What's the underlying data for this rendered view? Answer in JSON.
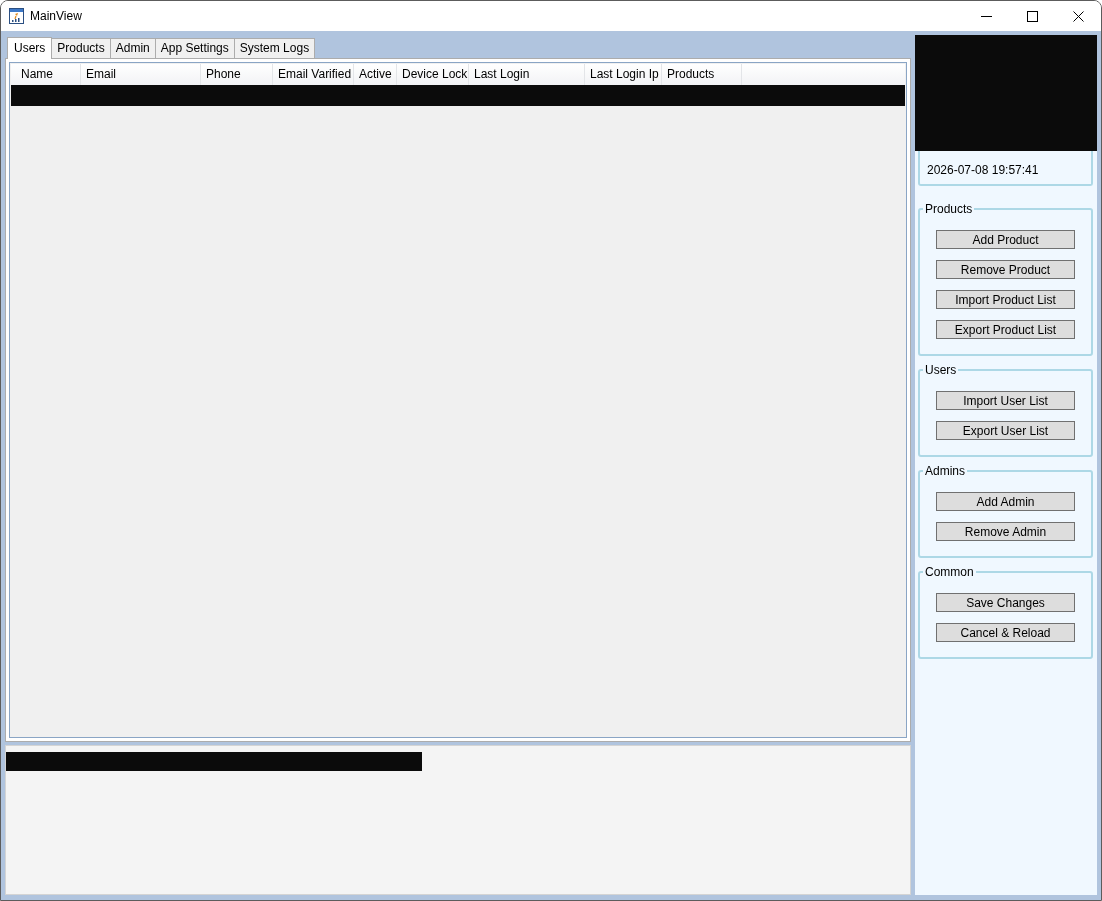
{
  "window": {
    "title": "MainView"
  },
  "tabs": [
    {
      "label": "Users",
      "selected": true
    },
    {
      "label": "Products",
      "selected": false
    },
    {
      "label": "Admin",
      "selected": false
    },
    {
      "label": "App Settings",
      "selected": false
    },
    {
      "label": "System Logs",
      "selected": false
    }
  ],
  "users_table": {
    "columns": [
      "Name",
      "Email",
      "Phone",
      "Email Varified",
      "Active",
      "Device Lock",
      "Last Login",
      "Last Login Ip",
      "Products"
    ],
    "rows": [
      {
        "redacted": true
      }
    ]
  },
  "log_panel": {
    "lines": [
      {
        "redacted": true
      }
    ]
  },
  "info_panel": {
    "header_redacted": true,
    "timestamp": "2026-07-08 19:57:41"
  },
  "groups": [
    {
      "title": "Products",
      "buttons": [
        "Add Product",
        "Remove Product",
        "Import Product List",
        "Export Product List"
      ]
    },
    {
      "title": "Users",
      "buttons": [
        "Import User List",
        "Export User List"
      ]
    },
    {
      "title": "Admins",
      "buttons": [
        "Add Admin",
        "Remove Admin"
      ]
    },
    {
      "title": "Common",
      "buttons": [
        "Save Changes",
        "Cancel & Reload"
      ]
    }
  ]
}
